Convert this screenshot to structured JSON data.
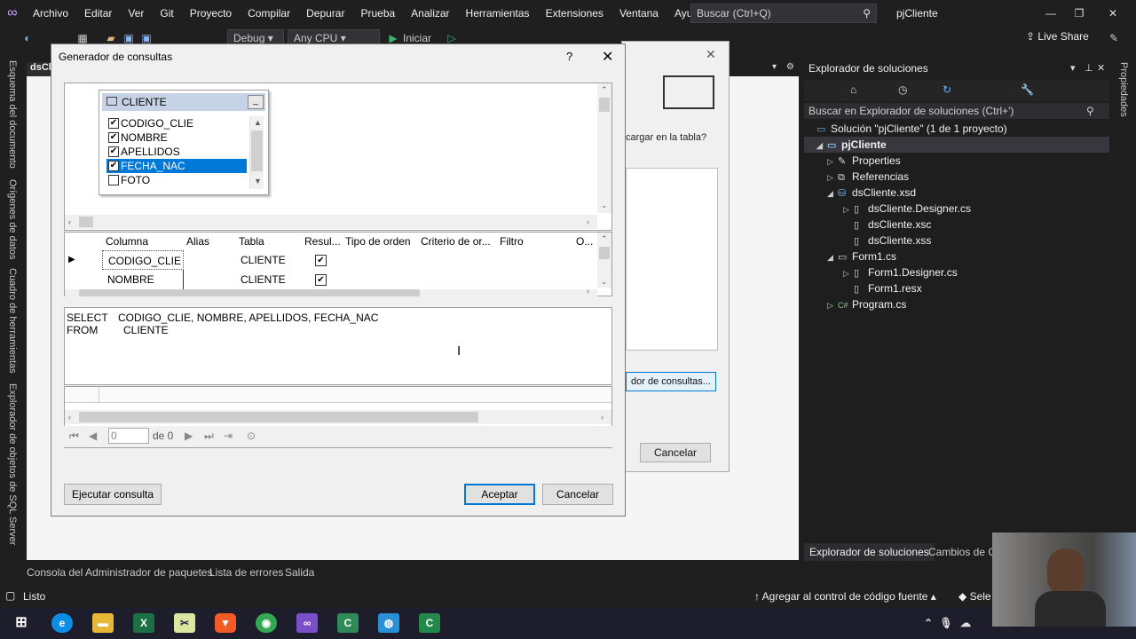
{
  "menu": {
    "items": [
      "Archivo",
      "Editar",
      "Ver",
      "Git",
      "Proyecto",
      "Compilar",
      "Depurar",
      "Prueba",
      "Analizar",
      "Herramientas",
      "Extensiones",
      "Ventana",
      "Ayuda"
    ],
    "search_placeholder": "Buscar (Ctrl+Q)",
    "solution_name": "pjCliente"
  },
  "toolbar": {
    "config": "Debug",
    "platform": "Any CPU",
    "start_label": "Iniciar",
    "live_share": "Live Share"
  },
  "left_strip": [
    "Esquema del documento",
    "Orígenes de datos",
    "Cuadro de herramientas",
    "Explorador de objetos de SQL Server"
  ],
  "editor": {
    "tab_label": "dsCli"
  },
  "behind_dialog": {
    "prompt": "cargar en la tabla?",
    "query_button": "dor de consultas...",
    "cancel": "Cancelar"
  },
  "dialog": {
    "title": "Generador de consultas",
    "help": "?",
    "table": {
      "name": "CLIENTE",
      "columns": [
        {
          "name": "CODIGO_CLIE",
          "checked": true,
          "selected": false
        },
        {
          "name": "NOMBRE",
          "checked": true,
          "selected": false
        },
        {
          "name": "APELLIDOS",
          "checked": true,
          "selected": false
        },
        {
          "name": "FECHA_NAC",
          "checked": true,
          "selected": true
        },
        {
          "name": "FOTO",
          "checked": false,
          "selected": false
        }
      ]
    },
    "grid": {
      "headers": [
        "Columna",
        "Alias",
        "Tabla",
        "Resul...",
        "Tipo de orden",
        "Criterio de or...",
        "Filtro",
        "O..."
      ],
      "rows": [
        {
          "columna": "CODIGO_CLIE",
          "tabla": "CLIENTE",
          "output": true
        },
        {
          "columna": "NOMBRE",
          "tabla": "CLIENTE",
          "output": true
        }
      ]
    },
    "sql": {
      "select_kw": "SELECT",
      "select_cols": "CODIGO_CLIE, NOMBRE, APELLIDOS, FECHA_NAC",
      "from_kw": "FROM",
      "from_table": "CLIENTE"
    },
    "nav": {
      "record": "0",
      "of": "de 0"
    },
    "execute_button": "Ejecutar consulta",
    "ok_button": "Aceptar",
    "cancel_button": "Cancelar"
  },
  "solution_explorer": {
    "title": "Explorador de soluciones",
    "search": "Buscar en Explorador de soluciones (Ctrl+')",
    "solution": "Solución \"pjCliente\" (1 de 1 proyecto)",
    "project": "pjCliente",
    "items": [
      "Properties",
      "Referencias",
      "dsCliente.xsd",
      "dsCliente.Designer.cs",
      "dsCliente.xsc",
      "dsCliente.xss",
      "Form1.cs",
      "Form1.Designer.cs",
      "Form1.resx",
      "Program.cs"
    ],
    "tab1": "Explorador de soluciones",
    "tab2": "Cambios de Gl"
  },
  "right_strip": "Propiedades",
  "bottom_tabs": [
    "Consola del Administrador de paquetes",
    "Lista de errores",
    "Salida"
  ],
  "status": {
    "left": "Listo",
    "source_control": "Agregar al control de código fuente",
    "repo": "Sele"
  }
}
